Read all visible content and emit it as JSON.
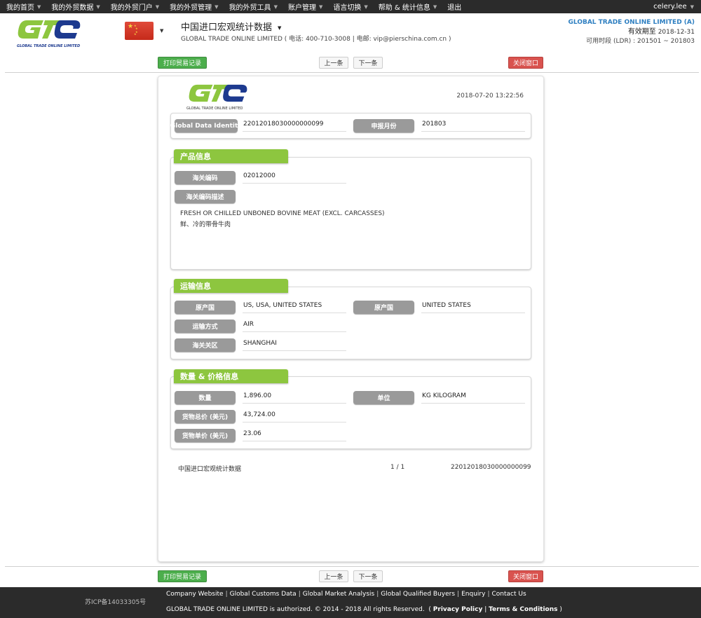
{
  "topnav": {
    "items": [
      {
        "label": "我的首页"
      },
      {
        "label": "我的外贸数据"
      },
      {
        "label": "我的外贸门户"
      },
      {
        "label": "我的外贸管理"
      },
      {
        "label": "我的外贸工具"
      },
      {
        "label": "账户管理"
      },
      {
        "label": "语言切换"
      },
      {
        "label": "帮助 & 统计信息"
      },
      {
        "label": "退出"
      }
    ],
    "caret": "▼",
    "user": "celery.lee"
  },
  "header": {
    "logo_text": "GLOBAL TRADE ONLINE LIMITED",
    "flag": "China",
    "title": "中国进口宏观统计数据",
    "subtitle": "GLOBAL TRADE ONLINE LIMITED ( 电话:  400-710-3008 | 电邮:  vip@pierschina.com.cn )",
    "company": "GLOBAL TRADE ONLINE LIMITED (A)",
    "valid_label": "有效期至",
    "valid_date": "2018-12-31",
    "period_label": "可用时段 (LDR) :",
    "period_value": "201501 ~ 201803"
  },
  "buttons": {
    "print": "打印贸易记录",
    "prev": "上一条",
    "next": "下一条",
    "close": "关闭窗口"
  },
  "document": {
    "logo_text": "GLOBAL TRADE ONLINE LIMITED",
    "timestamp": "2018-07-20 13:22:56",
    "identity": {
      "gdi_label": "Global Data Identity",
      "gdi_value": "22012018030000000099",
      "month_label": "申报月份",
      "month_value": "201803"
    },
    "product": {
      "title": "产品信息",
      "hs_label": "海关编码",
      "hs_value": "02012000",
      "hs_desc_label": "海关编码描述",
      "desc_en": "FRESH OR CHILLED UNBONED BOVINE MEAT (EXCL. CARCASSES)",
      "desc_cn": "鲜、冷的带骨牛肉"
    },
    "transport": {
      "title": "运输信息",
      "origin_label": "原产国",
      "origin_value": "US, USA, UNITED STATES",
      "origin2_label": "原产国",
      "origin2_value": "UNITED STATES",
      "mode_label": "运输方式",
      "mode_value": "AIR",
      "customs_label": "海关关区",
      "customs_value": "SHANGHAI"
    },
    "quantity": {
      "title": "数量 & 价格信息",
      "qty_label": "数量",
      "qty_value": "1,896.00",
      "unit_label": "单位",
      "unit_value": "KG KILOGRAM",
      "total_label": "货物总价 (美元)",
      "total_value": "43,724.00",
      "unit_price_label": "货物单价 (美元)",
      "unit_price_value": "23.06"
    },
    "footer": {
      "source": "中国进口宏观统计数据",
      "page": "1 / 1",
      "id": "22012018030000000099"
    }
  },
  "footer": {
    "icp": "苏ICP备14033305号",
    "links": [
      "Company Website",
      "Global Customs Data",
      "Global Market Analysis",
      "Global Qualified Buyers",
      "Enquiry",
      "Contact Us"
    ],
    "copyright": "GLOBAL TRADE ONLINE LIMITED is authorized. © 2014 - 2018 All rights Reserved.",
    "privacy": "Privacy Policy",
    "terms": "Terms & Conditions"
  }
}
